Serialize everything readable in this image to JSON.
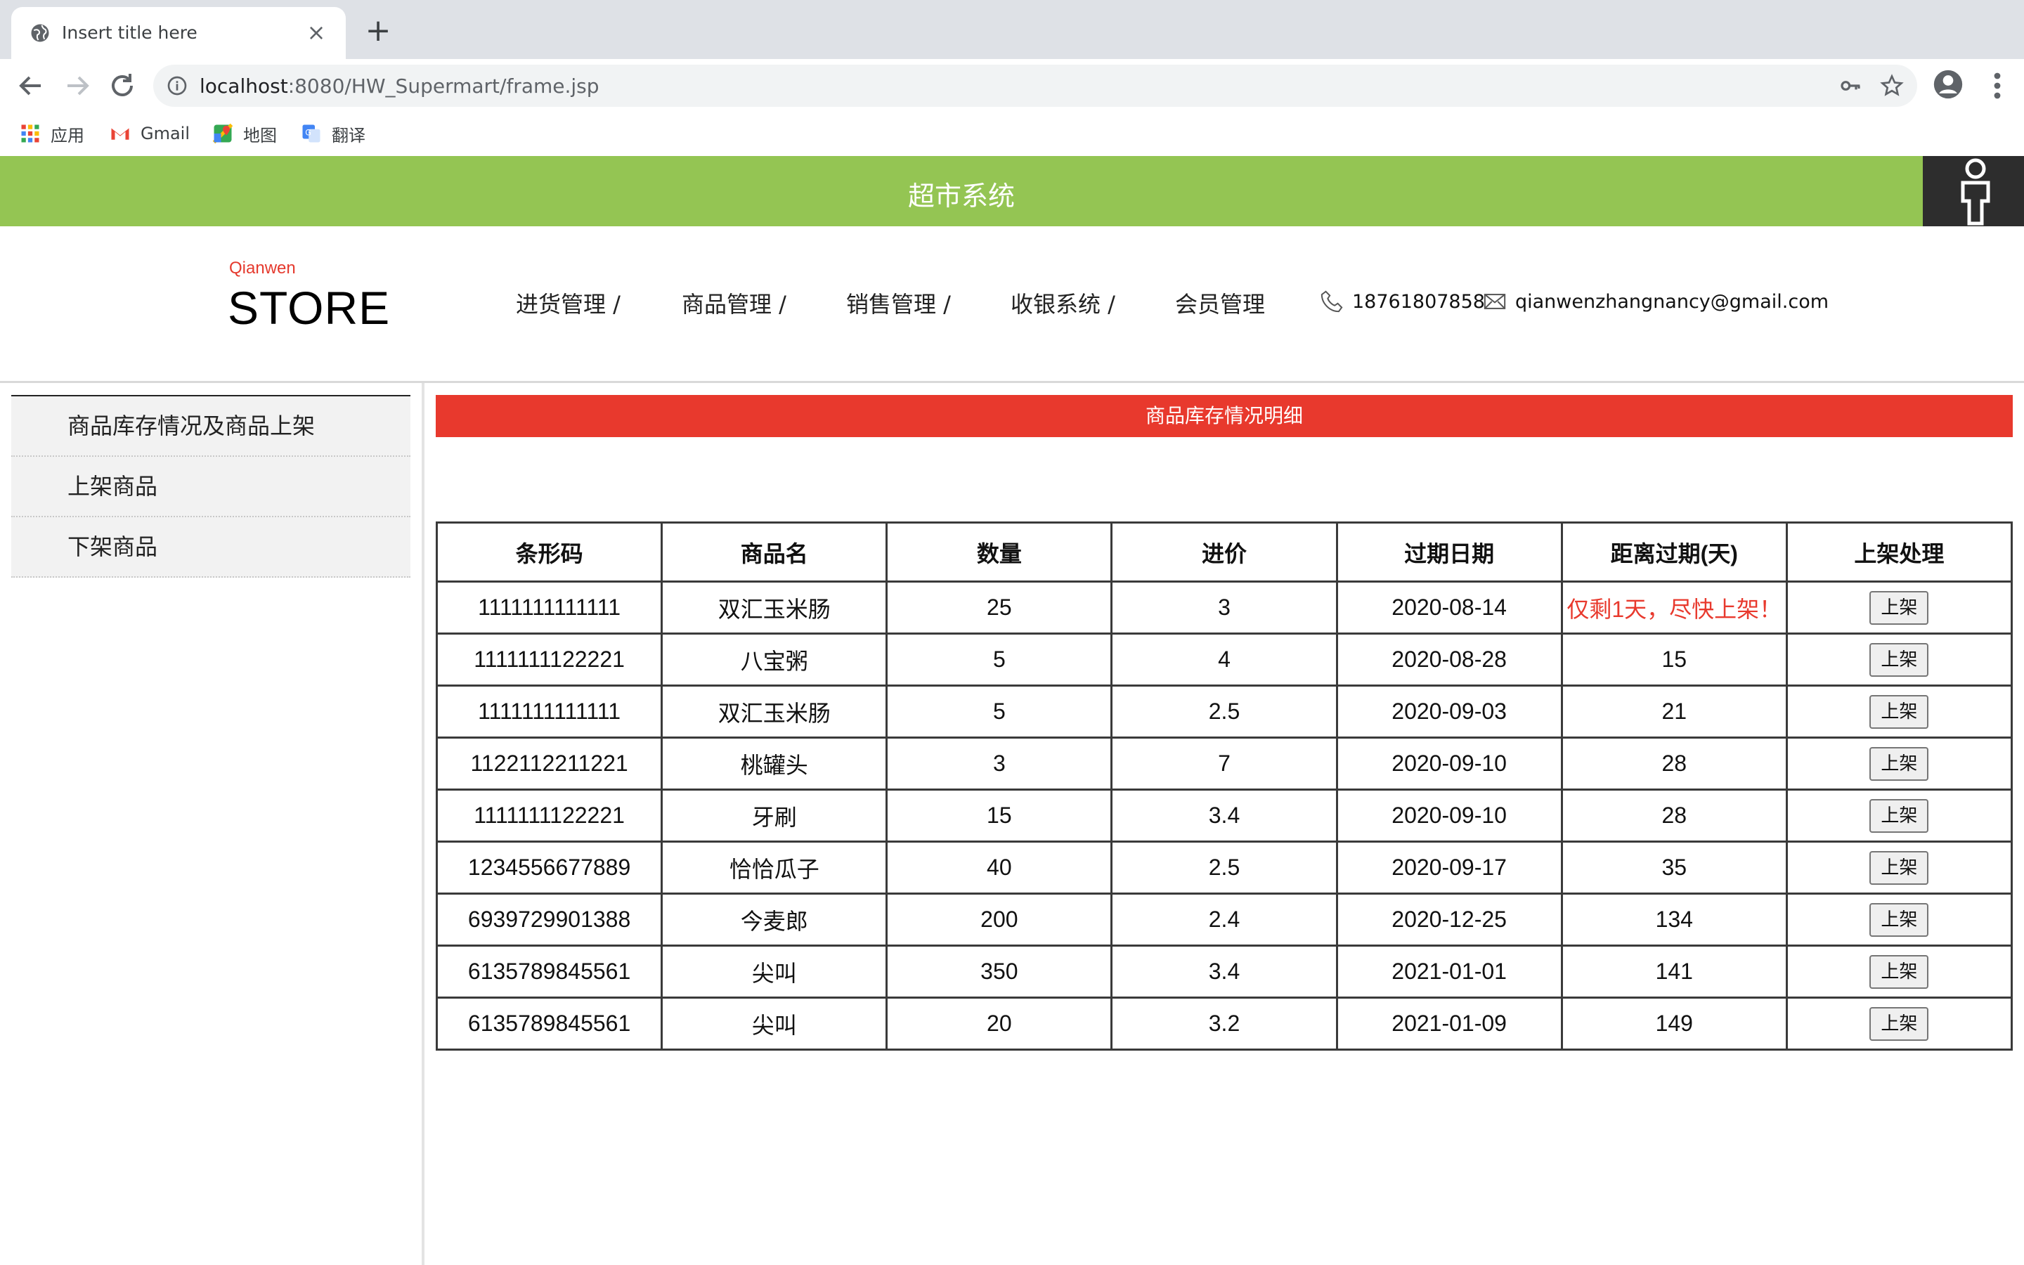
{
  "browser": {
    "tab_title": "Insert title here",
    "url_host": "localhost",
    "url_path": ":8080/HW_Supermart/frame.jsp",
    "bookmarks": [
      {
        "label": "应用",
        "icon": "apps-grid-icon"
      },
      {
        "label": "Gmail",
        "icon": "gmail-icon"
      },
      {
        "label": "地图",
        "icon": "maps-icon"
      },
      {
        "label": "翻译",
        "icon": "translate-icon"
      }
    ]
  },
  "header": {
    "system_title": "超市系统",
    "brand_sub": "Qianwen",
    "brand_main": "STORE"
  },
  "nav": {
    "items": [
      "进货管理 /",
      "商品管理 /",
      "销售管理 /",
      "收银系统 /",
      "会员管理"
    ],
    "phone": "18761807858",
    "email": "qianwenzhangnancy@gmail.com"
  },
  "sidebar": {
    "items": [
      "商品库存情况及商品上架",
      "上架商品",
      "下架商品"
    ]
  },
  "panel": {
    "title": "商品库存情况明细"
  },
  "table": {
    "headers": [
      "条形码",
      "商品名",
      "数量",
      "进价",
      "过期日期",
      "距离过期(天)",
      "上架处理"
    ],
    "button_label": "上架",
    "rows": [
      [
        "1111111111111",
        "双汇玉米肠",
        "25",
        "3",
        "2020-08-14",
        "仅剩1天，尽快上架！"
      ],
      [
        "1111111122221",
        "八宝粥",
        "5",
        "4",
        "2020-08-28",
        "15"
      ],
      [
        "1111111111111",
        "双汇玉米肠",
        "5",
        "2.5",
        "2020-09-03",
        "21"
      ],
      [
        "1122112211221",
        "桃罐头",
        "3",
        "7",
        "2020-09-10",
        "28"
      ],
      [
        "1111111122221",
        "牙刷",
        "15",
        "3.4",
        "2020-09-10",
        "28"
      ],
      [
        "1234556677889",
        "恰恰瓜子",
        "40",
        "2.5",
        "2020-09-17",
        "35"
      ],
      [
        "6939729901388",
        "今麦郎",
        "200",
        "2.4",
        "2020-12-25",
        "134"
      ],
      [
        "6135789845561",
        "尖叫",
        "350",
        "3.4",
        "2021-01-01",
        "141"
      ],
      [
        "6135789845561",
        "尖叫",
        "20",
        "3.2",
        "2021-01-09",
        "149"
      ]
    ]
  },
  "colors": {
    "topbar_green": "#94c553",
    "alert_red": "#e8392d",
    "user_box": "#2d2d2d"
  }
}
